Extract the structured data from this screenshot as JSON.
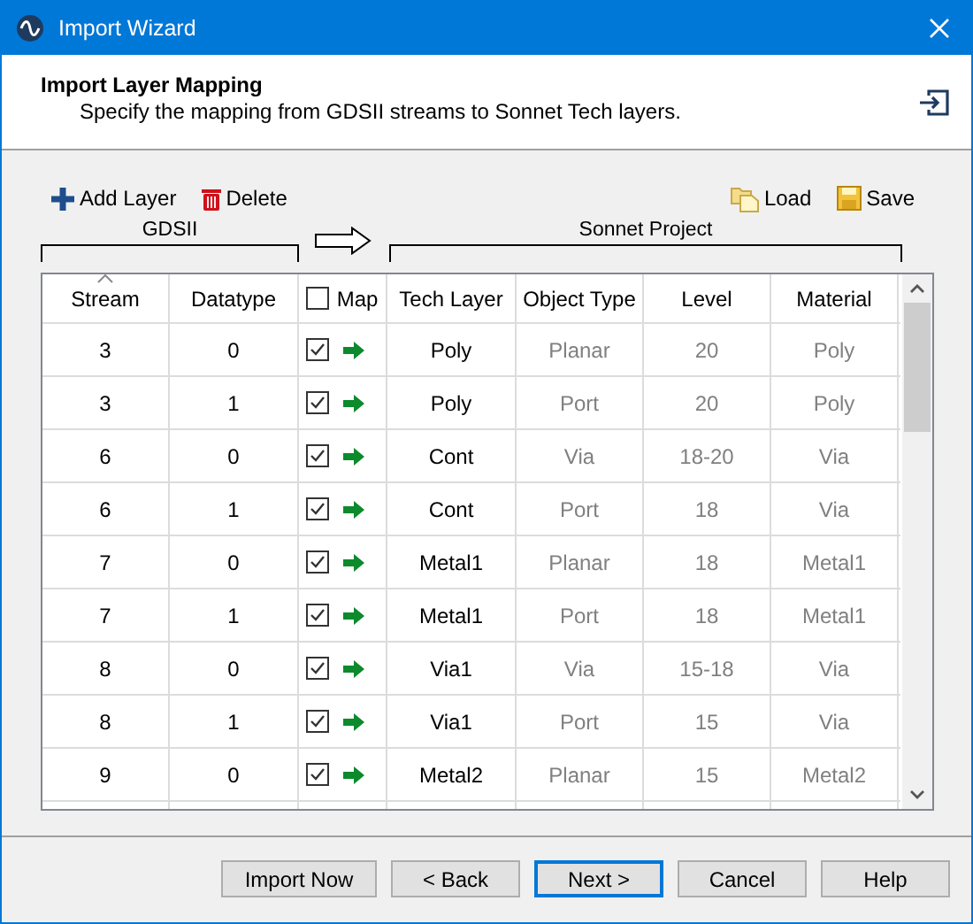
{
  "window": {
    "title": "Import Wizard"
  },
  "header": {
    "title": "Import Layer Mapping",
    "subtitle": "Specify the mapping from GDSII streams to Sonnet Tech layers."
  },
  "toolbar": {
    "left": [
      "Add Layer",
      "Delete"
    ],
    "right": [
      "Load",
      "Save"
    ]
  },
  "groups": {
    "left": "GDSII",
    "right": "Sonnet Project"
  },
  "table": {
    "columns": [
      {
        "label": "Stream",
        "sorted": true
      },
      {
        "label": "Datatype",
        "sorted": false
      },
      {
        "label": "Map",
        "sorted": false
      },
      {
        "label": "Tech Layer",
        "sorted": false
      },
      {
        "label": "Object Type",
        "sorted": false
      },
      {
        "label": "Level",
        "sorted": false
      },
      {
        "label": "Material",
        "sorted": false
      }
    ],
    "map_all_checked": false,
    "rows": [
      {
        "stream": "3",
        "datatype": "0",
        "checked": true,
        "tech_layer": "Poly",
        "object_type": "Planar",
        "level": "20",
        "material": "Poly"
      },
      {
        "stream": "3",
        "datatype": "1",
        "checked": true,
        "tech_layer": "Poly",
        "object_type": "Port",
        "level": "20",
        "material": "Poly"
      },
      {
        "stream": "6",
        "datatype": "0",
        "checked": true,
        "tech_layer": "Cont",
        "object_type": "Via",
        "level": "18-20",
        "material": "Via"
      },
      {
        "stream": "6",
        "datatype": "1",
        "checked": true,
        "tech_layer": "Cont",
        "object_type": "Port",
        "level": "18",
        "material": "Via"
      },
      {
        "stream": "7",
        "datatype": "0",
        "checked": true,
        "tech_layer": "Metal1",
        "object_type": "Planar",
        "level": "18",
        "material": "Metal1"
      },
      {
        "stream": "7",
        "datatype": "1",
        "checked": true,
        "tech_layer": "Metal1",
        "object_type": "Port",
        "level": "18",
        "material": "Metal1"
      },
      {
        "stream": "8",
        "datatype": "0",
        "checked": true,
        "tech_layer": "Via1",
        "object_type": "Via",
        "level": "15-18",
        "material": "Via"
      },
      {
        "stream": "8",
        "datatype": "1",
        "checked": true,
        "tech_layer": "Via1",
        "object_type": "Port",
        "level": "15",
        "material": "Via"
      },
      {
        "stream": "9",
        "datatype": "0",
        "checked": true,
        "tech_layer": "Metal2",
        "object_type": "Planar",
        "level": "15",
        "material": "Metal2"
      }
    ]
  },
  "buttons": [
    {
      "label": "Import Now",
      "focused": false
    },
    {
      "label": "< Back",
      "focused": false
    },
    {
      "label": "Next >",
      "focused": true
    },
    {
      "label": "Cancel",
      "focused": false
    },
    {
      "label": "Help",
      "focused": false
    }
  ]
}
